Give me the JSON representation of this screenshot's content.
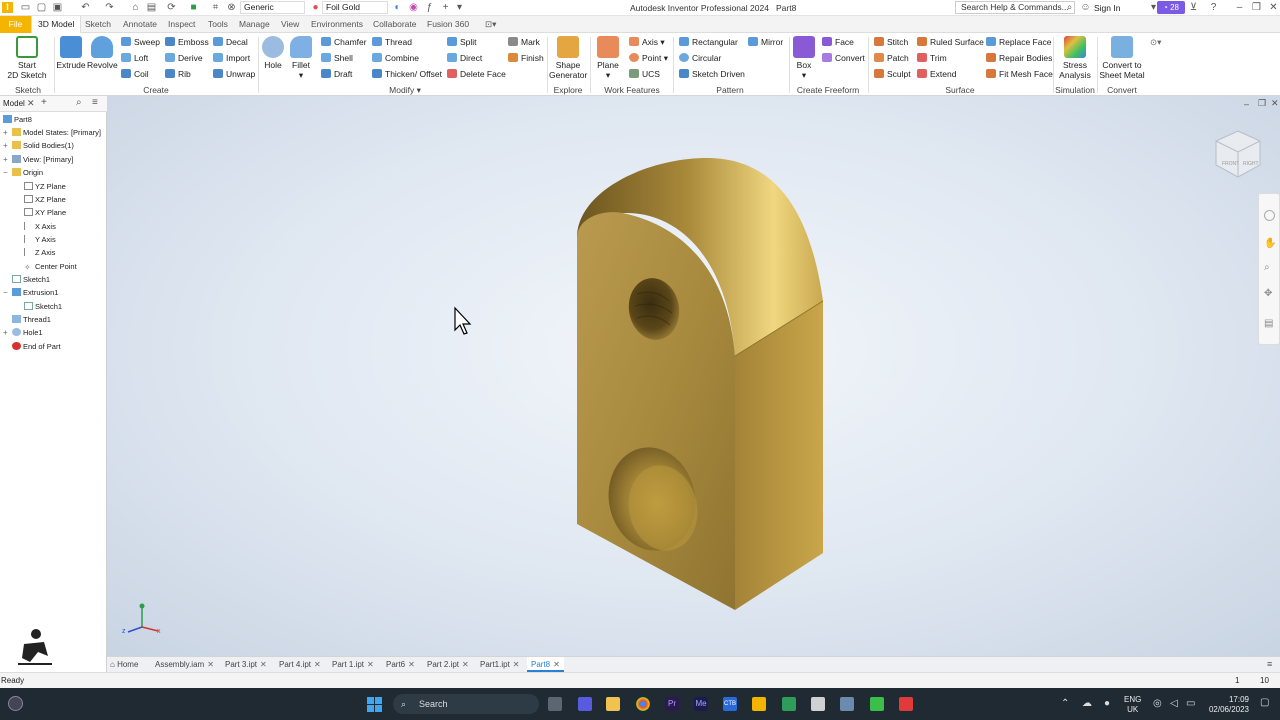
{
  "titlebar": {
    "app_title": "Autodesk Inventor Professional 2024",
    "doc_name": "Part8",
    "appearance_select": "Generic",
    "material_select": "Foil Gold",
    "search_placeholder": "Search Help & Commands...",
    "sign_in": "Sign In",
    "notification_count": "28"
  },
  "menu_tabs": [
    "File",
    "3D Model",
    "Sketch",
    "Annotate",
    "Inspect",
    "Tools",
    "Manage",
    "View",
    "Environments",
    "Collaborate",
    "Fusion 360"
  ],
  "ribbon": {
    "sketch": {
      "start_line1": "Start",
      "start_line2": "2D Sketch",
      "group": "Sketch"
    },
    "create": {
      "extrude": "Extrude",
      "revolve": "Revolve",
      "sweep": "Sweep",
      "loft": "Loft",
      "coil": "Coil",
      "emboss": "Emboss",
      "derive": "Derive",
      "rib": "Rib",
      "decal": "Decal",
      "import": "Import",
      "unwrap": "Unwrap",
      "group": "Create"
    },
    "modify": {
      "hole": "Hole",
      "fillet": "Fillet",
      "chamfer": "Chamfer",
      "shell": "Shell",
      "draft": "Draft",
      "thread": "Thread",
      "combine": "Combine",
      "thicken": "Thicken/ Offset",
      "split": "Split",
      "direct": "Direct",
      "delete_face": "Delete Face",
      "mark": "Mark",
      "finish": "Finish",
      "group": "Modify"
    },
    "explore": {
      "shape_line1": "Shape",
      "shape_line2": "Generator",
      "group": "Explore"
    },
    "work_features": {
      "plane": "Plane",
      "axis": "Axis",
      "point": "Point",
      "ucs": "UCS",
      "group": "Work Features"
    },
    "pattern": {
      "rectangular": "Rectangular",
      "circular": "Circular",
      "sketch_driven": "Sketch Driven",
      "mirror": "Mirror",
      "group": "Pattern"
    },
    "freeform": {
      "box": "Box",
      "face": "Face",
      "convert": "Convert",
      "group": "Create Freeform"
    },
    "surface": {
      "stitch": "Stitch",
      "patch": "Patch",
      "sculpt": "Sculpt",
      "ruled": "Ruled Surface",
      "trim": "Trim",
      "extend": "Extend",
      "replace_face": "Replace Face",
      "repair_bodies": "Repair Bodies",
      "fit_mesh": "Fit Mesh Face",
      "group": "Surface"
    },
    "simulation": {
      "stress_line1": "Stress",
      "stress_line2": "Analysis",
      "group": "Simulation"
    },
    "convert": {
      "sheet_line1": "Convert to",
      "sheet_line2": "Sheet Metal",
      "group": "Convert"
    }
  },
  "browser": {
    "tab": "Model",
    "items": [
      "Part8",
      "Model States: [Primary]",
      "Solid Bodies(1)",
      "View: [Primary]",
      "Origin",
      "YZ Plane",
      "XZ Plane",
      "XY Plane",
      "X Axis",
      "Y Axis",
      "Z Axis",
      "Center Point",
      "Sketch1",
      "Extrusion1",
      "Sketch1",
      "Thread1",
      "Hole1",
      "End of Part"
    ]
  },
  "doc_tabs": [
    "Home",
    "Assembly.iam",
    "Part 3.ipt",
    "Part 4.ipt",
    "Part 1.ipt",
    "Part6",
    "Part 2.ipt",
    "Part1.ipt",
    "Part8"
  ],
  "status": {
    "text": "Ready",
    "count1": "1",
    "count2": "10"
  },
  "taskbar": {
    "search": "Search",
    "lang": "ENG",
    "region": "UK",
    "time": "17:09",
    "date": "02/06/2023"
  },
  "colors": {
    "file_tab": "#f4b400",
    "gold": "#b8963a",
    "viewport_bg": "#dfe7f1"
  }
}
